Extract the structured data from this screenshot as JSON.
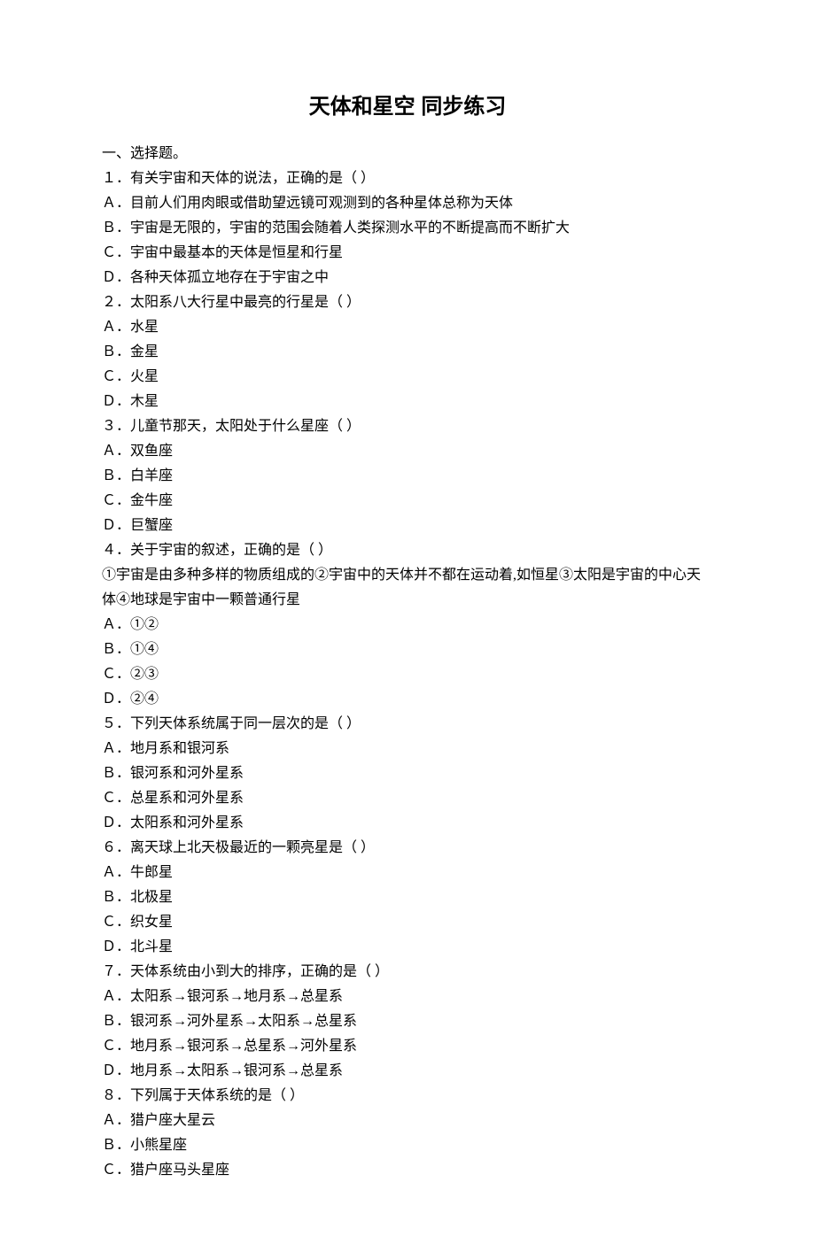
{
  "title": "天体和星空 同步练习",
  "section_header": "一、选择题。",
  "questions": [
    {
      "stem": "１．有关宇宙和天体的说法，正确的是（ ）",
      "options": [
        "Ａ．目前人们用肉眼或借助望远镜可观测到的各种星体总称为天体",
        "Ｂ．宇宙是无限的，宇宙的范围会随着人类探测水平的不断提高而不断扩大",
        "Ｃ．宇宙中最基本的天体是恒星和行星",
        "Ｄ．各种天体孤立地存在于宇宙之中"
      ]
    },
    {
      "stem": "２．太阳系八大行星中最亮的行星是（ ）",
      "options": [
        "Ａ．水星",
        "Ｂ．金星",
        "Ｃ．火星",
        "Ｄ．木星"
      ]
    },
    {
      "stem": "３．儿童节那天，太阳处于什么星座（ ）",
      "options": [
        "Ａ．双鱼座",
        "Ｂ．白羊座",
        "Ｃ．金牛座",
        "Ｄ．巨蟹座"
      ]
    },
    {
      "stem": "４．关于宇宙的叙述，正确的是（ ）",
      "sub": "①宇宙是由多种多样的物质组成的②宇宙中的天体并不都在运动着,如恒星③太阳是宇宙的中心天体④地球是宇宙中一颗普通行星",
      "options": [
        "Ａ．①②",
        "Ｂ．①④",
        "Ｃ．②③",
        "Ｄ．②④"
      ]
    },
    {
      "stem": "５．下列天体系统属于同一层次的是（ ）",
      "options": [
        "Ａ．地月系和银河系",
        "Ｂ．银河系和河外星系",
        "Ｃ．总星系和河外星系",
        "Ｄ．太阳系和河外星系"
      ]
    },
    {
      "stem": "６．离天球上北天极最近的一颗亮星是（ ）",
      "options": [
        "Ａ．牛郎星",
        "Ｂ．北极星",
        "Ｃ．织女星",
        "Ｄ．北斗星"
      ]
    },
    {
      "stem": "７．天体系统由小到大的排序，正确的是（ ）",
      "options": [
        "Ａ．太阳系→银河系→地月系→总星系",
        "Ｂ．银河系→河外星系→太阳系→总星系",
        "Ｃ．地月系→银河系→总星系→河外星系",
        "Ｄ．地月系→太阳系→银河系→总星系"
      ]
    },
    {
      "stem": "８．下列属于天体系统的是（ ）",
      "options": [
        "Ａ．猎户座大星云",
        "Ｂ．小熊星座",
        "Ｃ．猎户座马头星座"
      ]
    }
  ]
}
